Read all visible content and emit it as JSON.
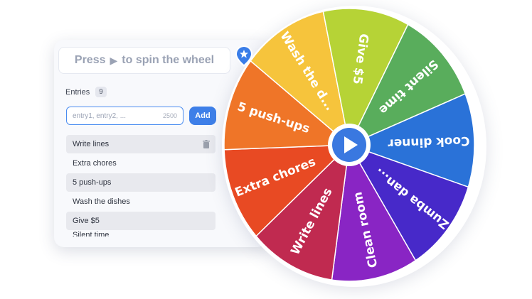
{
  "spin_hint": {
    "before": "Press",
    "after": "to spin the wheel"
  },
  "entries": {
    "label": "Entries",
    "count": "9",
    "input_placeholder": "entry1, entry2, ...",
    "char_limit": "2500",
    "add_label": "Add",
    "items": [
      "Write lines",
      "Extra chores",
      "5 push-ups",
      "Wash the dishes",
      "Give $5",
      "Silent time"
    ]
  },
  "wheel": {
    "segments": [
      {
        "label": "Extra chores",
        "color": "#e84a23"
      },
      {
        "label": "5 push-ups",
        "color": "#ef7528"
      },
      {
        "label": "Wash the d...",
        "color": "#f6c43c"
      },
      {
        "label": "Give $5",
        "color": "#b6d336"
      },
      {
        "label": "Silent time",
        "color": "#59ad5c"
      },
      {
        "label": "Cook dinner",
        "color": "#2a72d8"
      },
      {
        "label": "Zumba dan...",
        "color": "#4729c9"
      },
      {
        "label": "Clean room",
        "color": "#8925c4"
      },
      {
        "label": "Write lines",
        "color": "#c02a50"
      }
    ],
    "center_button_color": "#3a78e0",
    "text_color": "#ffffff",
    "marker_color": "#3a7de8"
  }
}
